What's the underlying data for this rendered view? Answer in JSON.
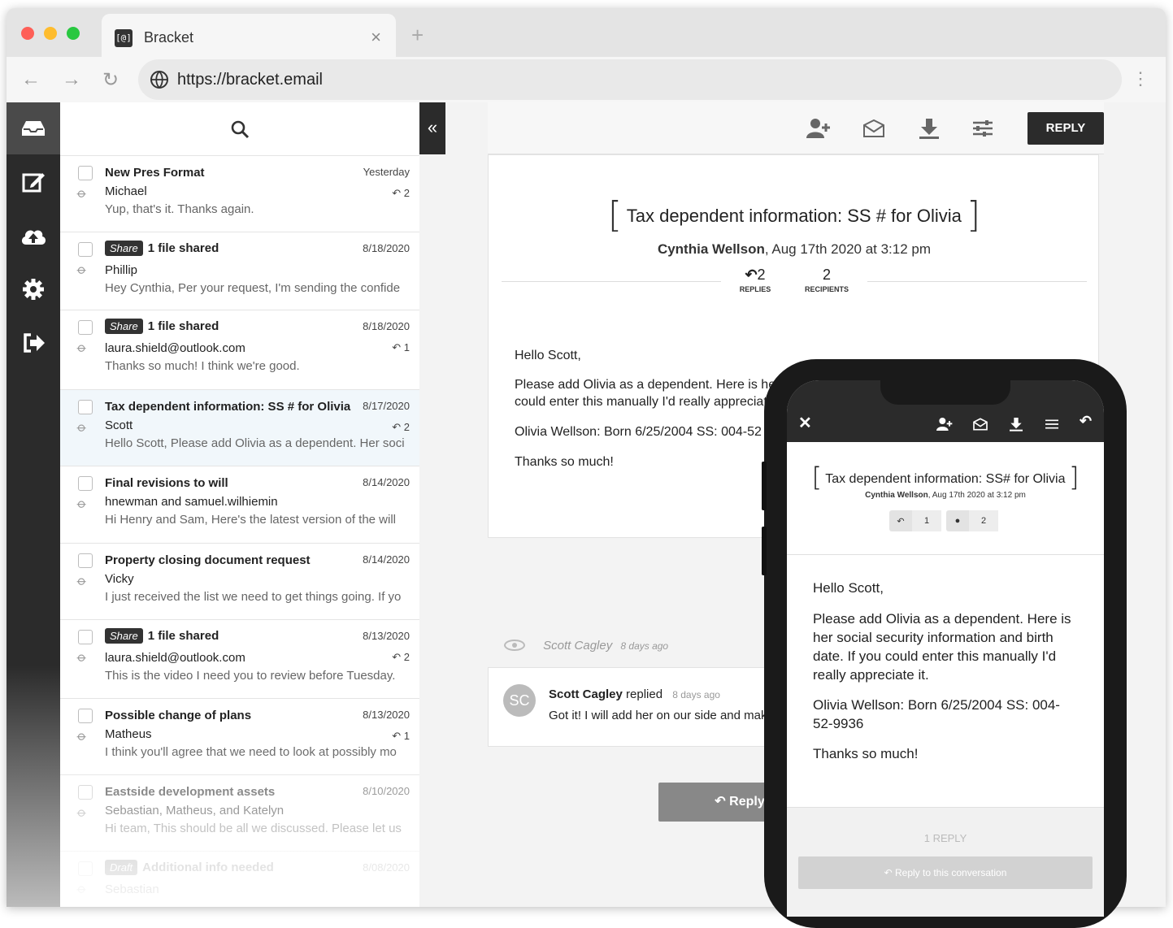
{
  "browser": {
    "tab_title": "Bracket",
    "tab_favicon": "[@]",
    "tab_close": "×",
    "new_tab": "+",
    "url": "https://bracket.email",
    "back": "←",
    "forward": "→",
    "reload": "↻",
    "menu": "⋮",
    "dot_colors": [
      "#fe5f57",
      "#febc2e",
      "#28c840"
    ]
  },
  "collapse_label": "«",
  "messages": [
    {
      "subject": "New Pres Format",
      "share": "",
      "date": "Yesterday",
      "from": "Michael",
      "replies": "2",
      "preview": "Yup, that's it. Thanks again."
    },
    {
      "subject": "1 file shared",
      "share": "Share",
      "date": "8/18/2020",
      "from": "Phillip",
      "replies": "",
      "preview": "Hey Cynthia, Per your request, I'm sending the confide"
    },
    {
      "subject": "1 file shared",
      "share": "Share",
      "date": "8/18/2020",
      "from": "laura.shield@outlook.com",
      "replies": "1",
      "preview": "Thanks so much! I think we're good."
    },
    {
      "subject": "Tax dependent information: SS # for Olivia",
      "share": "",
      "date": "8/17/2020",
      "from": "Scott",
      "replies": "2",
      "preview": "Hello Scott, Please add Olivia as a dependent. Her soci"
    },
    {
      "subject": "Final revisions to will",
      "share": "",
      "date": "8/14/2020",
      "from": "hnewman and samuel.wilhiemin",
      "replies": "",
      "preview": "Hi Henry and Sam, Here's the latest version of the will"
    },
    {
      "subject": "Property closing document request",
      "share": "",
      "date": "8/14/2020",
      "from": "Vicky",
      "replies": "",
      "preview": "I just received the list we need to get things going. If yo"
    },
    {
      "subject": "1 file shared",
      "share": "Share",
      "date": "8/13/2020",
      "from": "laura.shield@outlook.com",
      "replies": "2",
      "preview": "This is the video I need you to review before Tuesday."
    },
    {
      "subject": "Possible change of plans",
      "share": "",
      "date": "8/13/2020",
      "from": "Matheus",
      "replies": "1",
      "preview": "I think you'll agree that we need to look at possibly mo"
    },
    {
      "subject": "Eastside development assets",
      "share": "",
      "date": "8/10/2020",
      "from": "Sebastian, Matheus, and Katelyn",
      "replies": "",
      "preview": "Hi team, This should be all we discussed. Please let us k"
    },
    {
      "subject": "Additional info needed",
      "share": "Draft",
      "date": "8/08/2020",
      "from": "Sebastian",
      "replies": "",
      "preview": ""
    }
  ],
  "reader": {
    "reply_button": "REPLY",
    "title": "Tax dependent information: SS # for Olivia",
    "bracket_open": "[",
    "bracket_close": "]",
    "sender": "Cynthia Wellson",
    "sent": ", Aug 17th 2020 at 3:12 pm",
    "replies_count": "2",
    "replies_label": "REPLIES",
    "recipients_count": "2",
    "recipients_label": "RECIPIENTS",
    "greeting": "Hello Scott,",
    "para1_line1": "Please add Olivia as a dependent. Here is her",
    "para1_line2": "could enter this manually I'd really appreciat",
    "para2": "Olivia Wellson: Born 6/25/2004 SS: 004-52",
    "closing": "Thanks so much!",
    "seen_by": "Scott Cagley",
    "seen_ago": "8 days ago",
    "reply_initials": "SC",
    "reply_name": "Scott Cagley",
    "reply_verb": " replied",
    "reply_ago": "8 days ago",
    "reply_text": "Got it! I will add her on our side and mak",
    "big_reply": "Reply"
  },
  "phone": {
    "close": "✕",
    "title": "Tax dependent information: SS# for Olivia",
    "bracket_open": "[",
    "bracket_close": "]",
    "sender": "Cynthia Wellson",
    "sent": ", Aug 17th 2020 at 3:12 pm",
    "replies_count": "1",
    "recipients_count": "2",
    "greeting": "Hello Scott,",
    "para1": "Please add Olivia as a dependent. Here is her social security information and birth date. If you could enter this manually I'd really appreciate it.",
    "para2": "Olivia Wellson: Born 6/25/2004 SS: 004-52-9936",
    "closing": "Thanks so much!",
    "reply_count_label": "1 REPLY",
    "reply_button": "Reply to this conversation"
  }
}
